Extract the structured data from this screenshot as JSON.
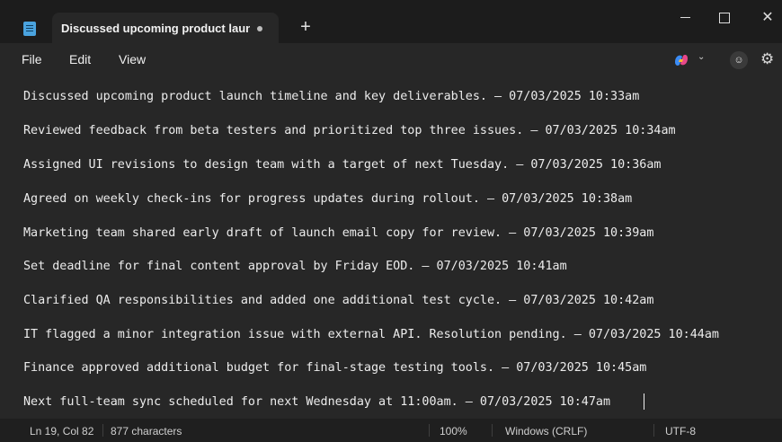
{
  "tab": {
    "title": "Discussed upcoming product launc",
    "new_tab": "+"
  },
  "menu": {
    "file": "File",
    "edit": "Edit",
    "view": "View"
  },
  "window_controls": {
    "close": "✕"
  },
  "editor": {
    "lines": [
      "Discussed upcoming product launch timeline and key deliverables. — 07/03/2025 10:33am",
      "Reviewed feedback from beta testers and prioritized top three issues. — 07/03/2025 10:34am",
      "Assigned UI revisions to design team with a target of next Tuesday. — 07/03/2025 10:36am",
      "Agreed on weekly check-ins for progress updates during rollout. — 07/03/2025 10:38am",
      "Marketing team shared early draft of launch email copy for review. — 07/03/2025 10:39am",
      "Set deadline for final content approval by Friday EOD. — 07/03/2025 10:41am",
      "Clarified QA responsibilities and added one additional test cycle. — 07/03/2025 10:42am",
      "IT flagged a minor integration issue with external API. Resolution pending. — 07/03/2025 10:44am",
      "Finance approved additional budget for final-stage testing tools. — 07/03/2025 10:45am",
      "Next full-team sync scheduled for next Wednesday at 11:00am. — 07/03/2025 10:47am"
    ]
  },
  "status": {
    "position": "Ln 19, Col 82",
    "characters": "877 characters",
    "zoom": "100%",
    "line_ending": "Windows (CRLF)",
    "encoding": "UTF-8"
  },
  "icons": {
    "app": "notepad-icon",
    "copilot": "copilot-icon",
    "account": "account-icon",
    "settings": "gear-icon"
  },
  "colors": {
    "background": "#272727",
    "titlebar": "#1c1c1c",
    "text": "#ececec",
    "app_icon": "#4aa3df"
  }
}
